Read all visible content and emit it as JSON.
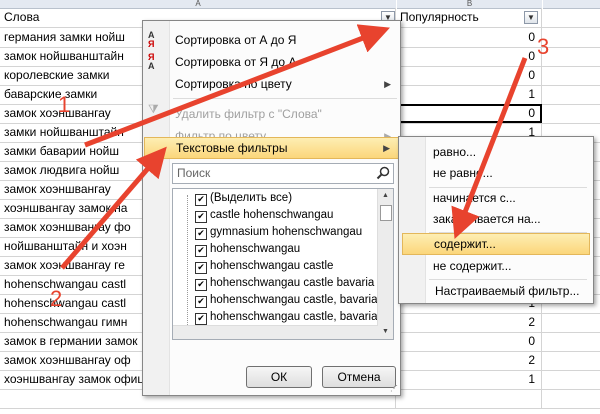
{
  "columns": {
    "a": "A",
    "b": "B"
  },
  "header": {
    "col_a": "Слова",
    "col_b": "Популярность"
  },
  "rows": [
    {
      "word": "германия замки нойш",
      "pop": "0"
    },
    {
      "word": "замок нойшванштайн",
      "pop": "0"
    },
    {
      "word": "королевские замки",
      "pop": "0"
    },
    {
      "word": "баварские замки",
      "pop": "1"
    },
    {
      "word": "замок хоэншвангау",
      "pop": "0"
    },
    {
      "word": "замки нойшванштайн",
      "pop": "1"
    },
    {
      "word": "замки баварии нойш",
      "pop": "1"
    },
    {
      "word": "замок людвига нойш",
      "pop": "1"
    },
    {
      "word": "замок хоэншвангау",
      "pop": "1"
    },
    {
      "word": "хоэншвангау замок на",
      "pop": "1"
    },
    {
      "word": "замок хоэншвангау фо",
      "pop": "1"
    },
    {
      "word": "нойшванштайн и хоэн",
      "pop": "1"
    },
    {
      "word": "замок хоэншвангау ге",
      "pop": "1"
    },
    {
      "word": "hohenschwangau castl",
      "pop": "1"
    },
    {
      "word": "hohenschwangau castl",
      "pop": "1"
    },
    {
      "word": "hohenschwangau гимн",
      "pop": "2"
    },
    {
      "word": "замок в германии замок",
      "pop": "0"
    },
    {
      "word": "замок хоэншвангау оф",
      "pop": "2"
    },
    {
      "word": "хоэншвангау замок официальный сайт",
      "pop": "1"
    },
    {
      "word": "",
      "pop": ""
    }
  ],
  "filter_menu": {
    "sort_az": "Сортировка от А до Я",
    "sort_za": "Сортировка от Я до А",
    "sort_color": "Сортировка по цвету",
    "clear_filter": "Удалить фильтр с \"Слова\"",
    "filter_color": "Фильтр по цвету",
    "text_filters": "Текстовые фильтры",
    "search_placeholder": "Поиск",
    "items": [
      "(Выделить все)",
      "castle hohenschwangau",
      "gymnasium hohenschwangau",
      "hohenschwangau",
      "hohenschwangau castle",
      "hohenschwangau castle bavaria",
      "hohenschwangau castle, bavaria ger",
      "hohenschwangau castle, bavaria ger",
      "hohenschwangau gymnasium"
    ],
    "ok": "ОК",
    "cancel": "Отмена"
  },
  "submenu": {
    "equals": "равно...",
    "not_equal": "не равно...",
    "begins": "начинается с...",
    "ends": "заканчивается на...",
    "contains": "содержит...",
    "not_contains": "не содержит...",
    "custom": "Настраиваемый фильтр..."
  },
  "annotations": {
    "n1": "1",
    "n2": "2",
    "n3": "3",
    "color": "#e8432e"
  }
}
